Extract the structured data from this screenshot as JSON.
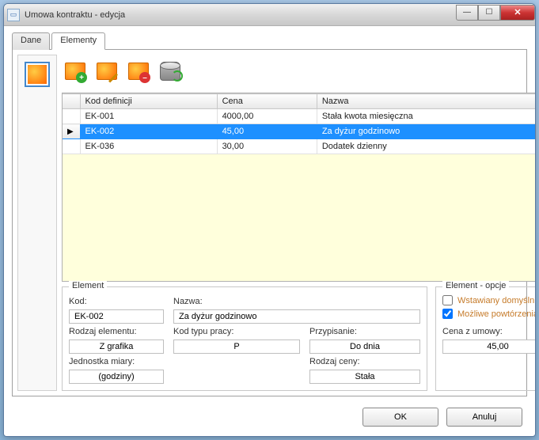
{
  "window": {
    "title": "Umowa kontraktu - edycja"
  },
  "tabs": {
    "dane": "Dane",
    "elementy": "Elementy"
  },
  "toolbar": {
    "add": "add-image-icon",
    "edit": "edit-image-icon",
    "delete": "delete-image-icon",
    "refresh": "refresh-db-icon"
  },
  "grid": {
    "headers": {
      "kod": "Kod definicji",
      "cena": "Cena",
      "nazwa": "Nazwa"
    },
    "rows": [
      {
        "kod": "EK-001",
        "cena": "4000,00",
        "nazwa": "Stała kwota miesięczna",
        "selected": false
      },
      {
        "kod": "EK-002",
        "cena": "45,00",
        "nazwa": "Za dyżur godzinowo",
        "selected": true
      },
      {
        "kod": "EK-036",
        "cena": "30,00",
        "nazwa": "Dodatek dzienny",
        "selected": false
      }
    ]
  },
  "element": {
    "group_title": "Element",
    "kod_label": "Kod:",
    "kod_value": "EK-002",
    "nazwa_label": "Nazwa:",
    "nazwa_value": "Za dyżur godzinowo",
    "rodzaj_label": "Rodzaj elementu:",
    "rodzaj_value": "Z grafika",
    "kodtypu_label": "Kod typu pracy:",
    "kodtypu_value": "P",
    "przypis_label": "Przypisanie:",
    "przypis_value": "Do dnia",
    "jedn_label": "Jednostka miary:",
    "jedn_value": "(godziny)",
    "rodzajceny_label": "Rodzaj ceny:",
    "rodzajceny_value": "Stała"
  },
  "opcje": {
    "group_title": "Element - opcje",
    "wstaw_label": "Wstawiany domyślnie",
    "powt_label": "Możliwe powtórzenia",
    "cena_label": "Cena z umowy:",
    "cena_value": "45,00"
  },
  "buttons": {
    "ok": "OK",
    "anuluj": "Anuluj"
  }
}
